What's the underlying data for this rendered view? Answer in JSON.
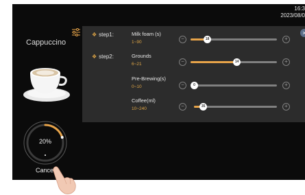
{
  "status_bar": {
    "time": "16:3",
    "date": "2023/08/0"
  },
  "drink": {
    "name": "Cappuccino"
  },
  "progress": {
    "percent": 20,
    "label": "20%"
  },
  "actions": {
    "cancel_label": "Cancel"
  },
  "steps": [
    {
      "label": "step1:",
      "params": [
        {
          "name": "Milk foam (s)",
          "range": "1~90",
          "value": 18,
          "min": 1,
          "max": 90
        }
      ]
    },
    {
      "label": "step2:",
      "params": [
        {
          "name": "Grounds",
          "range": "6~21",
          "value": 14,
          "min": 6,
          "max": 21
        },
        {
          "name": "Pre-Brewing(s)",
          "range": "0~10",
          "value": 0,
          "min": 0,
          "max": 10
        },
        {
          "name": "Coffee(ml)",
          "range": "10~240",
          "value": 35,
          "min": 10,
          "max": 240
        }
      ]
    }
  ],
  "colors": {
    "accent": "#e6a349",
    "panel": "#2c2c2c",
    "background": "#0b0b0b"
  },
  "icons": {
    "settings": "sliders-icon",
    "close": "close-icon",
    "minus": "minus-icon",
    "plus": "plus-icon"
  }
}
